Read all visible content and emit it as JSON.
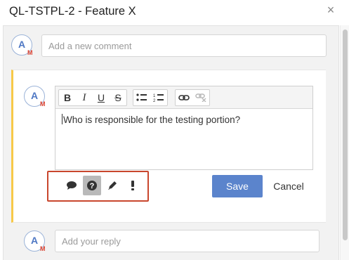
{
  "dialog": {
    "title": "QL-TSTPL-2 - Feature X",
    "close_glyph": "×"
  },
  "avatar": {
    "initial": "A",
    "badge": "M",
    "initial_color": "#4f78c4",
    "badge_color": "#d9402f"
  },
  "new_comment": {
    "placeholder": "Add a new comment"
  },
  "editor": {
    "toolbar": {
      "bold": "B",
      "italic": "I",
      "underline": "U",
      "strike": "S"
    },
    "content": "Who is responsible for the testing portion?"
  },
  "comment_types": [
    {
      "name": "comment",
      "icon": "speech-bubble-icon",
      "glyph": "💬",
      "selected": false
    },
    {
      "name": "question",
      "icon": "question-circle-icon",
      "glyph": "?",
      "selected": true
    },
    {
      "name": "edit",
      "icon": "pencil-icon",
      "glyph": "✎",
      "selected": false
    },
    {
      "name": "important",
      "icon": "exclamation-icon",
      "glyph": "!",
      "selected": false
    }
  ],
  "actions": {
    "save": "Save",
    "cancel": "Cancel"
  },
  "reply": {
    "placeholder": "Add your reply"
  },
  "colors": {
    "accent_bar": "#f7c948",
    "save_button": "#5b84cc",
    "highlight_box": "#c9462d"
  }
}
